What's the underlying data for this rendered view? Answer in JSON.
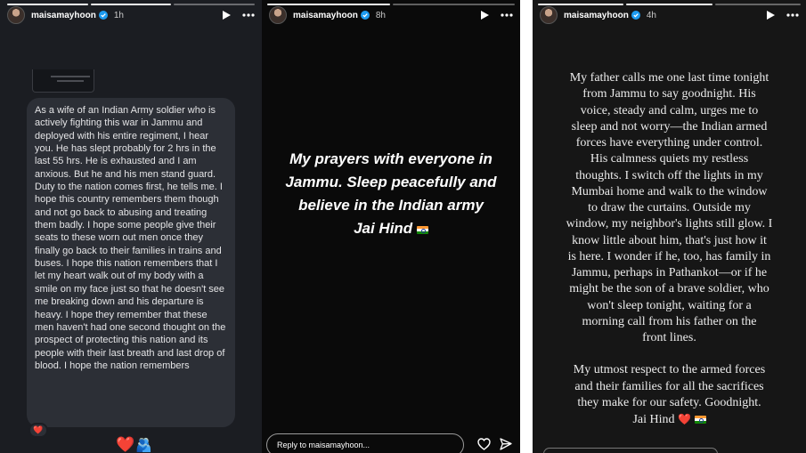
{
  "panels": [
    {
      "username": "maisamayhoon",
      "time": "1h",
      "message": "As a wife of an Indian Army soldier who is actively fighting this war in Jammu and deployed with his entire regiment, I hear you. He has slept probably for 2 hrs in the last 55 hrs. He is exhausted and I am anxious. But he and his men stand guard. Duty to the nation comes first, he tells me. I hope this country remembers them though and not go back to abusing and treating them badly. I hope some people give their seats to these worn out men once they finally go back to their families in trains and buses. I hope this nation remembers that I let my heart walk out of my body with a smile on my face just so that he doesn't see me breaking down and his departure is heavy. I hope they remember that these men haven't had one second thought on the prospect of protecting this nation and its people with their last breath and last drop of blood. I hope the nation remembers",
      "reaction": "❤️",
      "bottom_emojis": [
        "❤️",
        "🫂"
      ]
    },
    {
      "username": "maisamayhoon",
      "time": "8h",
      "story_lines": [
        "My prayers with everyone in",
        "Jammu. Sleep peacefully and",
        "believe in the Indian army",
        "Jai Hind"
      ],
      "reply_placeholder": "Reply to maisamayhoon..."
    },
    {
      "username": "maisamayhoon",
      "time": "4h",
      "paragraph1_lines": [
        "My father calls me one last time tonight",
        "from Jammu to say goodnight. His",
        "voice, steady and calm, urges me to",
        "sleep and not worry—the Indian armed",
        "forces have everything under control.",
        "His calmness quiets my restless",
        "thoughts. I switch off the lights in my",
        "Mumbai home and walk to the window",
        "to draw the curtains. Outside my",
        "window, my neighbor's lights still glow. I",
        "know little about him, that's just how it",
        "is here. I wonder if he, too, has family in",
        "Jammu, perhaps in Pathankot—or if he",
        "might be the son of a brave soldier, who",
        "won't sleep tonight, waiting for a",
        "morning call from his father on the",
        "front lines."
      ],
      "paragraph2_lines": [
        "My utmost respect to the armed forces",
        "and their families for all the sacrifices",
        "they make for our safety. Goodnight.",
        "Jai Hind"
      ],
      "sign_off_emoji": "❤️"
    }
  ],
  "icons": {
    "verified": "verified-badge-icon",
    "play": "play-icon",
    "more": "more-options-icon",
    "like": "heart-outline-icon",
    "send": "send-icon",
    "flag": "india-flag-icon"
  },
  "colors": {
    "verified_blue": "#1d9bf0",
    "heart_red": "#e0243c"
  }
}
